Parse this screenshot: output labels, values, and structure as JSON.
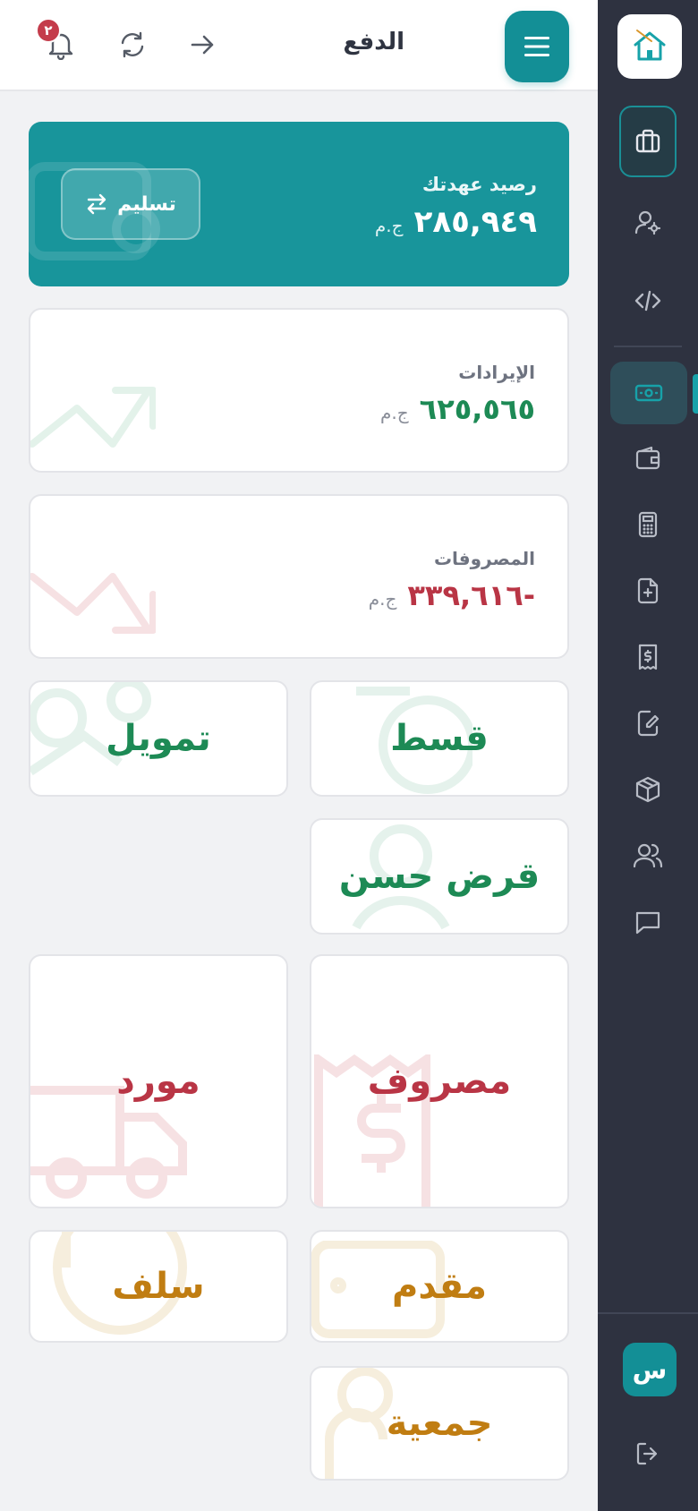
{
  "header": {
    "title": "الدفع",
    "notifications_count": "٢"
  },
  "balance": {
    "label": "رصيد عهدتك",
    "value": "٢٨٥,٩٤٩",
    "currency": "ج.م",
    "button_label": "تسليم"
  },
  "revenue": {
    "label": "الإيرادات",
    "value": "٦٢٥,٥٦٥",
    "currency": "ج.م"
  },
  "expenses": {
    "label": "المصروفات",
    "value": "-٣٣٩,٦١٦",
    "currency": "ج.م"
  },
  "tiles": {
    "installment": "قسط",
    "financing": "تمويل",
    "good_loan": "قرض حسن",
    "expense": "مصروف",
    "supplier": "مورد",
    "down_payment": "مقدم",
    "advances": "سلف",
    "association": "جمعية"
  },
  "user": {
    "avatar_letter": "س"
  },
  "colors": {
    "primary": "#138f96",
    "sidebar": "#2e3240",
    "green": "#1d8a55",
    "red": "#b93545",
    "gold": "#c07d12"
  }
}
